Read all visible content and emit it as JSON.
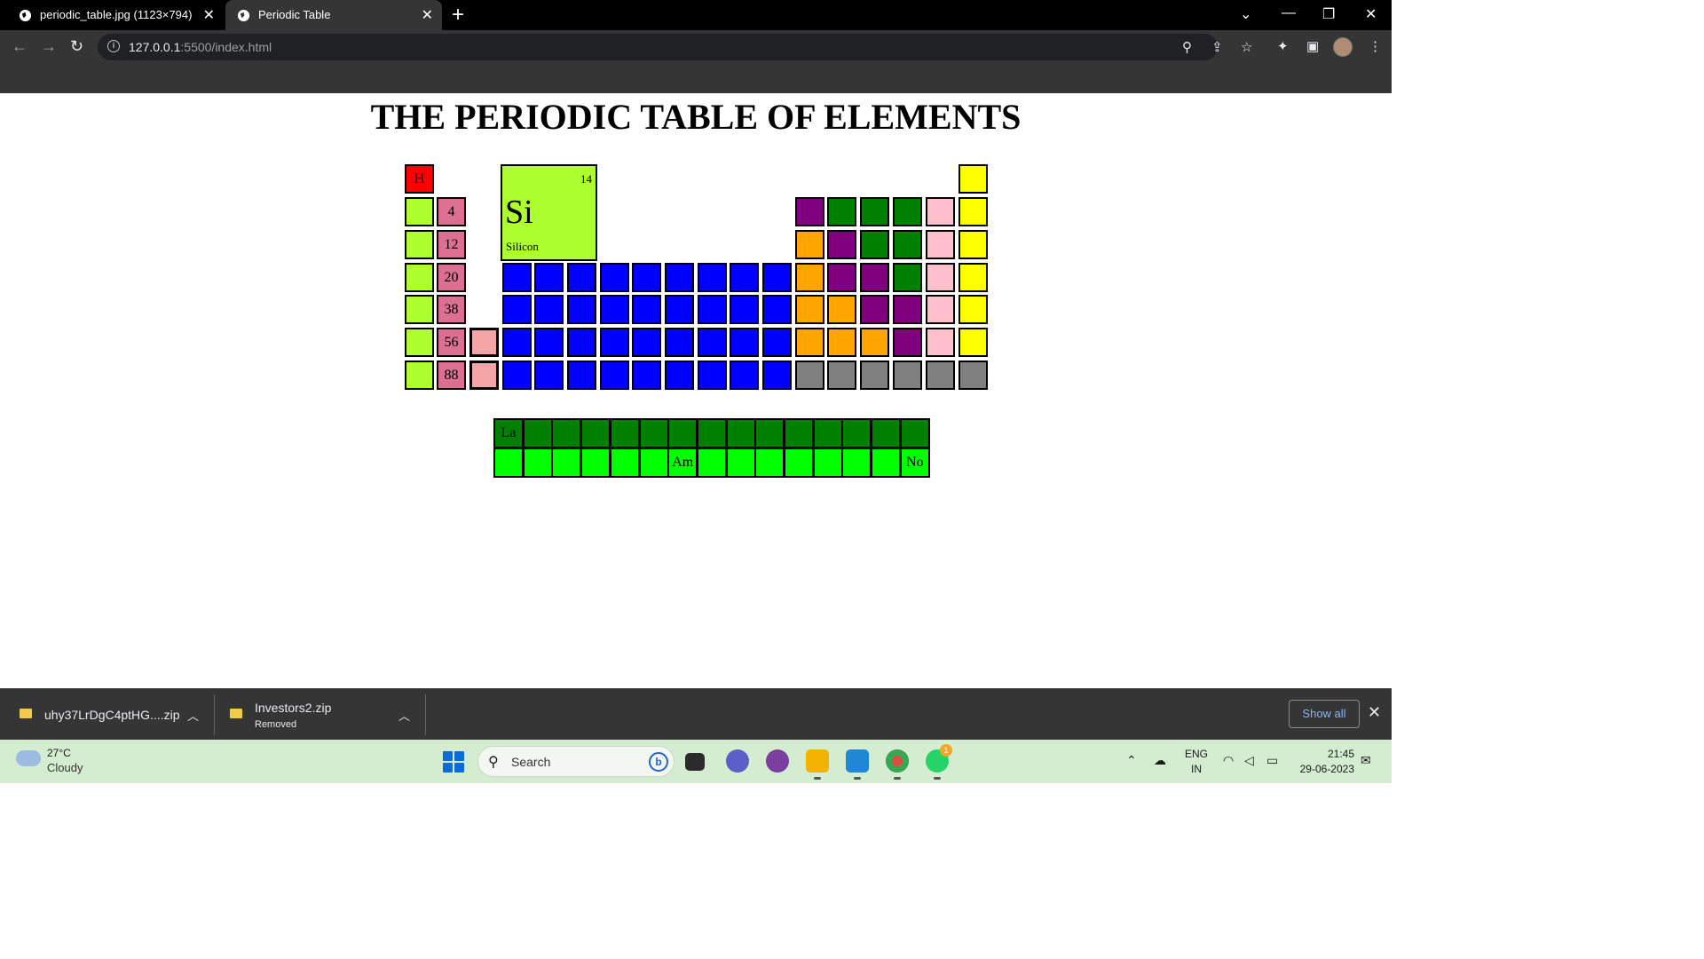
{
  "browser": {
    "tabs": [
      {
        "title": "periodic_table.jpg (1123×794)",
        "active": false
      },
      {
        "title": "Periodic Table",
        "active": true
      }
    ],
    "url_host": "127.0.0.1",
    "url_path": ":5500/index.html"
  },
  "page": {
    "title": "THE PERIODIC TABLE OF ELEMENTS",
    "featured": {
      "number": "14",
      "symbol": "Si",
      "name": "Silicon",
      "color": "#adff2f"
    },
    "main_cells": [
      {
        "text": "H",
        "color": "#ff0000",
        "textColor": "#000000"
      },
      {
        "text": "",
        "color": "#ffff00"
      },
      {
        "text": "",
        "color": "#adff2f"
      },
      {
        "text": "4",
        "color": "#db7093"
      },
      {
        "text": "",
        "color": "#800080"
      },
      {
        "text": "",
        "color": "#008000"
      },
      {
        "text": "",
        "color": "#008000"
      },
      {
        "text": "",
        "color": "#008000"
      },
      {
        "text": "",
        "color": "#ffc0cb"
      },
      {
        "text": "",
        "color": "#ffff00"
      },
      {
        "text": "",
        "color": "#adff2f"
      },
      {
        "text": "12",
        "color": "#db7093"
      },
      {
        "text": "",
        "color": "#ffa500"
      },
      {
        "text": "",
        "color": "#800080"
      },
      {
        "text": "",
        "color": "#008000"
      },
      {
        "text": "",
        "color": "#008000"
      },
      {
        "text": "",
        "color": "#ffc0cb"
      },
      {
        "text": "",
        "color": "#ffff00"
      },
      {
        "text": "",
        "color": "#adff2f"
      },
      {
        "text": "20",
        "color": "#db7093"
      },
      {
        "text": "",
        "color": "#0000ff"
      },
      {
        "text": "",
        "color": "#0000ff"
      },
      {
        "text": "",
        "color": "#0000ff"
      },
      {
        "text": "",
        "color": "#0000ff"
      },
      {
        "text": "",
        "color": "#0000ff"
      },
      {
        "text": "",
        "color": "#0000ff"
      },
      {
        "text": "",
        "color": "#0000ff"
      },
      {
        "text": "",
        "color": "#0000ff"
      },
      {
        "text": "",
        "color": "#0000ff"
      },
      {
        "text": "",
        "color": "#ffa500"
      },
      {
        "text": "",
        "color": "#800080"
      },
      {
        "text": "",
        "color": "#800080"
      },
      {
        "text": "",
        "color": "#008000"
      },
      {
        "text": "",
        "color": "#ffc0cb"
      },
      {
        "text": "",
        "color": "#ffff00"
      },
      {
        "text": "",
        "color": "#adff2f"
      },
      {
        "text": "38",
        "color": "#db7093"
      },
      {
        "text": "",
        "color": "#0000ff"
      },
      {
        "text": "",
        "color": "#0000ff"
      },
      {
        "text": "",
        "color": "#0000ff"
      },
      {
        "text": "",
        "color": "#0000ff"
      },
      {
        "text": "",
        "color": "#0000ff"
      },
      {
        "text": "",
        "color": "#0000ff"
      },
      {
        "text": "",
        "color": "#0000ff"
      },
      {
        "text": "",
        "color": "#0000ff"
      },
      {
        "text": "",
        "color": "#0000ff"
      },
      {
        "text": "",
        "color": "#ffa500"
      },
      {
        "text": "",
        "color": "#ffa500"
      },
      {
        "text": "",
        "color": "#800080"
      },
      {
        "text": "",
        "color": "#800080"
      },
      {
        "text": "",
        "color": "#ffc0cb"
      },
      {
        "text": "",
        "color": "#ffff00"
      },
      {
        "text": "",
        "color": "#adff2f"
      },
      {
        "text": "56",
        "color": "#db7093"
      },
      {
        "text": "",
        "color": "#f4a6a6"
      },
      {
        "text": "",
        "color": "#0000ff"
      },
      {
        "text": "",
        "color": "#0000ff"
      },
      {
        "text": "",
        "color": "#0000ff"
      },
      {
        "text": "",
        "color": "#0000ff"
      },
      {
        "text": "",
        "color": "#0000ff"
      },
      {
        "text": "",
        "color": "#0000ff"
      },
      {
        "text": "",
        "color": "#0000ff"
      },
      {
        "text": "",
        "color": "#0000ff"
      },
      {
        "text": "",
        "color": "#0000ff"
      },
      {
        "text": "",
        "color": "#ffa500"
      },
      {
        "text": "",
        "color": "#ffa500"
      },
      {
        "text": "",
        "color": "#ffa500"
      },
      {
        "text": "",
        "color": "#800080"
      },
      {
        "text": "",
        "color": "#ffc0cb"
      },
      {
        "text": "",
        "color": "#ffff00"
      },
      {
        "text": "",
        "color": "#adff2f"
      },
      {
        "text": "88",
        "color": "#db7093"
      },
      {
        "text": "",
        "color": "#f4a6a6"
      },
      {
        "text": "",
        "color": "#0000ff"
      },
      {
        "text": "",
        "color": "#0000ff"
      },
      {
        "text": "",
        "color": "#0000ff"
      },
      {
        "text": "",
        "color": "#0000ff"
      },
      {
        "text": "",
        "color": "#0000ff"
      },
      {
        "text": "",
        "color": "#0000ff"
      },
      {
        "text": "",
        "color": "#0000ff"
      },
      {
        "text": "",
        "color": "#0000ff"
      },
      {
        "text": "",
        "color": "#0000ff"
      },
      {
        "text": "",
        "color": "#808080"
      },
      {
        "text": "",
        "color": "#808080"
      },
      {
        "text": "",
        "color": "#808080"
      },
      {
        "text": "",
        "color": "#808080"
      },
      {
        "text": "",
        "color": "#808080"
      },
      {
        "text": "",
        "color": "#808080"
      }
    ],
    "lanthanides": {
      "color": "#008000",
      "cells": [
        "La",
        "",
        "",
        "",
        "",
        "",
        "",
        "",
        "",
        "",
        "",
        "",
        "",
        "",
        ""
      ]
    },
    "actinides": {
      "color": "#00ff00",
      "cells": [
        "",
        "",
        "",
        "",
        "",
        "",
        "Am",
        "",
        "",
        "",
        "",
        "",
        "",
        "",
        "No"
      ]
    }
  },
  "downloads": {
    "items": [
      {
        "name": "uhy37LrDgC4ptHG....zip",
        "status": ""
      },
      {
        "name": "Investors2.zip",
        "status": "Removed"
      }
    ],
    "show_all": "Show all"
  },
  "taskbar": {
    "weather_temp": "27°C",
    "weather_condition": "Cloudy",
    "search_placeholder": "Search",
    "lang_top": "ENG",
    "lang_bottom": "IN",
    "time": "21:45",
    "date": "29-06-2023",
    "whatsapp_badge": "1"
  }
}
